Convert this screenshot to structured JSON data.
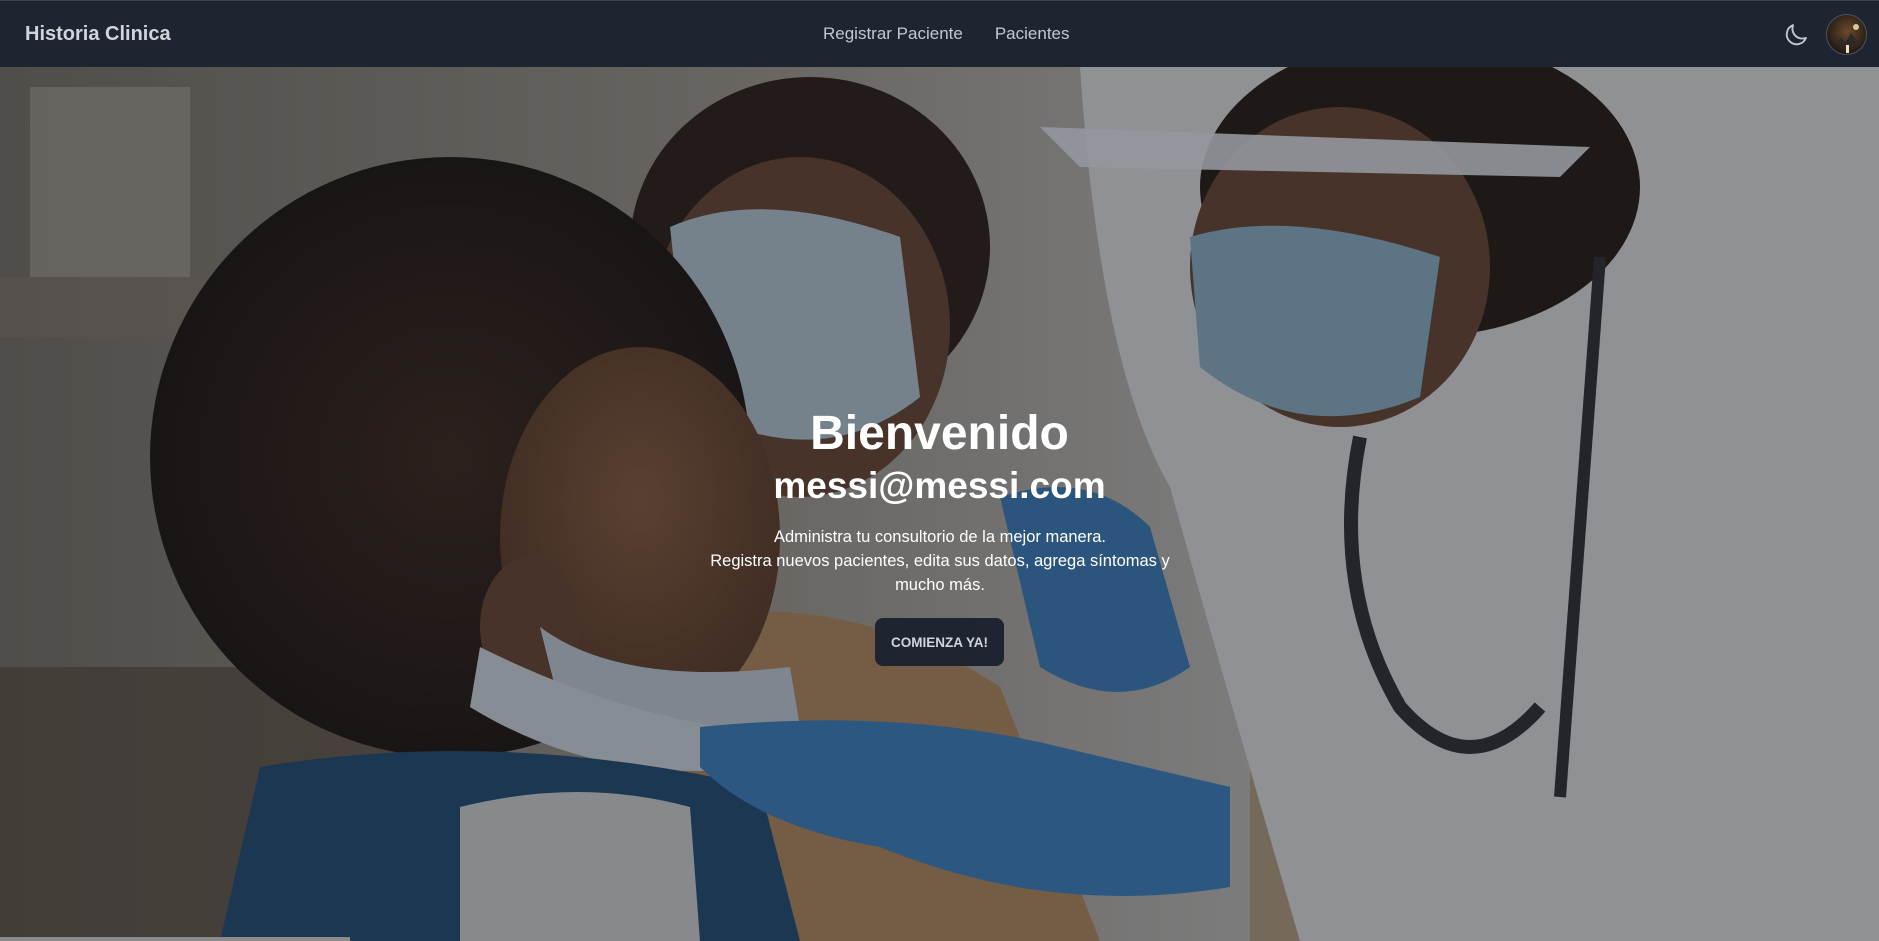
{
  "navbar": {
    "brand": "Historia Clinica",
    "links": [
      {
        "label": "Registrar Paciente"
      },
      {
        "label": "Pacientes"
      }
    ],
    "theme_toggle_icon": "moon-icon",
    "avatar_icon": "user-avatar"
  },
  "hero": {
    "title": "Bienvenido",
    "email": "messi@messi.com",
    "description_line1": "Administra tu consultorio de la mejor manera.",
    "description_line2": "Registra nuevos pacientes, edita sus datos, agrega síntomas y mucho más.",
    "cta_label": "COMIENZA YA!",
    "background_image": "photo of a doctor in protective gear examining a child's mouth"
  },
  "colors": {
    "navbar_bg": "#1f2530",
    "button_bg": "#1f2530",
    "text_light": "#ffffff",
    "nav_text": "#c3c8d0"
  }
}
